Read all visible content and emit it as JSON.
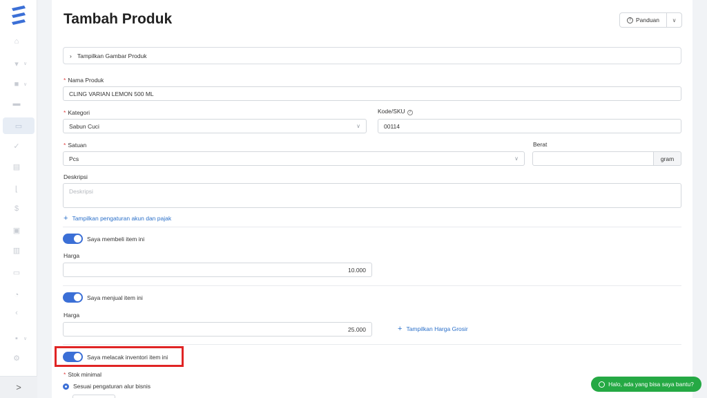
{
  "sidebar": {
    "icons": [
      "home-icon",
      "cart-icon",
      "bag-icon",
      "card-icon",
      "box-icon",
      "check-icon",
      "briefcase-icon",
      "chart-icon",
      "dollar-icon",
      "document-icon",
      "building-icon",
      "receipt-icon",
      "gauge-icon",
      "pie-icon",
      "report-icon",
      "settings-icon"
    ],
    "expand_glyph": ">"
  },
  "page": {
    "title": "Tambah Produk",
    "guide_label": "Panduan"
  },
  "image_section": {
    "label": "Tampilkan Gambar Produk"
  },
  "form": {
    "name": {
      "label": "Nama Produk",
      "value": "CLING VARIAN LEMON 500 ML"
    },
    "category": {
      "label": "Kategori",
      "value": "Sabun Cuci"
    },
    "sku": {
      "label": "Kode/SKU",
      "value": "00114"
    },
    "unit": {
      "label": "Satuan",
      "value": "Pcs"
    },
    "weight": {
      "label": "Berat",
      "value": "",
      "unit": "gram"
    },
    "description": {
      "label": "Deskripsi",
      "placeholder": "Deskripsi"
    },
    "account_tax_link": "Tampilkan pengaturan akun dan pajak"
  },
  "purchase": {
    "toggle_label": "Saya membeli item ini",
    "price_label": "Harga",
    "price": "10.000"
  },
  "sales": {
    "toggle_label": "Saya menjual item ini",
    "price_label": "Harga",
    "price": "25.000",
    "wholesale_link": "Tampilkan Harga Grosir"
  },
  "inventory": {
    "toggle_label": "Saya melacak inventori item ini",
    "min_stock_label": "Stok minimal",
    "option_label": "Sesuai pengaturan alur bisnis"
  },
  "chat": {
    "label": "Halo, ada yang bisa saya bantu?"
  },
  "colors": {
    "accent": "#3b6fd6",
    "link": "#2a6fc9",
    "highlight": "#e02424",
    "chat": "#25a944"
  }
}
